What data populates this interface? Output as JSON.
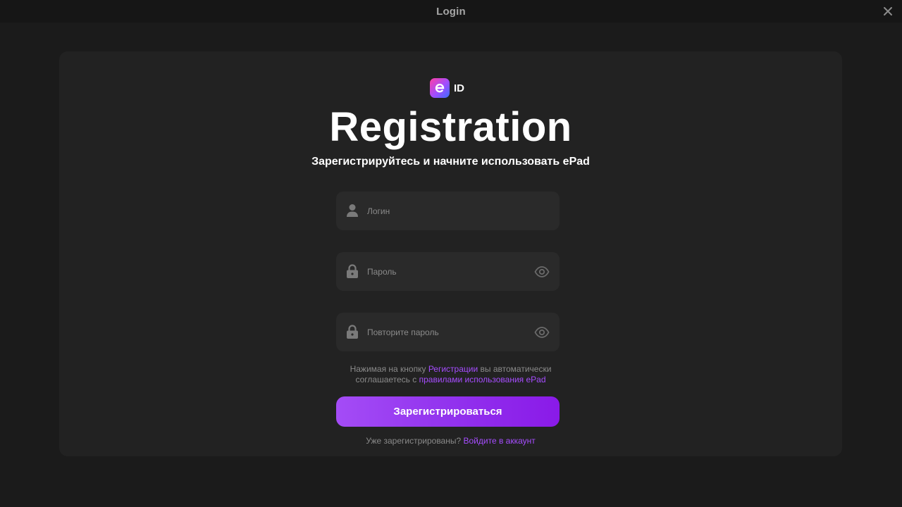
{
  "window": {
    "title": "Login",
    "close_icon": "close-icon"
  },
  "brand": {
    "logo_letter": "e",
    "logo_text": "ID",
    "gradient": [
      "#ff3ea5",
      "#a04dff",
      "#3b6dff"
    ]
  },
  "page": {
    "heading": "Registration",
    "subtitle": "Зарегистрируйтесь и начните использовать ePad"
  },
  "form": {
    "login": {
      "icon": "user-icon",
      "placeholder": "Логин",
      "value": ""
    },
    "password": {
      "icon": "lock-icon",
      "placeholder": "Пароль",
      "value": "",
      "toggle_icon": "eye-icon"
    },
    "repeat_password": {
      "icon": "lock-icon",
      "placeholder": "Повторите пароль",
      "value": "",
      "toggle_icon": "eye-icon"
    }
  },
  "terms": {
    "prefix": "Нажимая на кнопку ",
    "link_register": "Регистрации",
    "middle": " вы автоматически",
    "line2_prefix": "соглашаетесь с ",
    "link_rules": "правилами использования ePad"
  },
  "submit_label": "Зарегистрироваться",
  "footer": {
    "question": "Уже зарегистрированы? ",
    "login_link": "Войдите в аккаунт"
  },
  "colors": {
    "background": "#1b1b1b",
    "card": "#222222",
    "field": "#2a2a2a",
    "accent": "#a64dff"
  }
}
